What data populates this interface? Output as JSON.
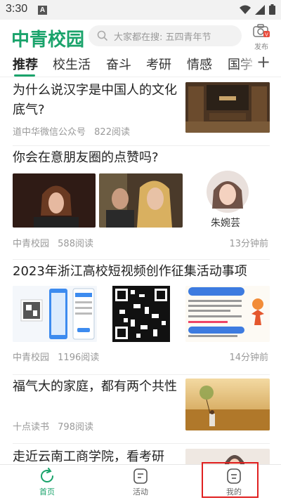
{
  "status_bar": {
    "time": "3:30",
    "notification": "A"
  },
  "header": {
    "logo": "中青校园",
    "search_placeholder": "大家都在搜: 五四青年节",
    "publish_label": "发布",
    "publish_badge": "V"
  },
  "tabs": [
    "推荐",
    "校生活",
    "奋斗",
    "考研",
    "情感",
    "国学"
  ],
  "tab_plus": "+",
  "articles": [
    {
      "title": "为什么说汉字是中国人的文化底气?",
      "source": "道中华微信公众号",
      "reads": "822阅读",
      "time": ""
    },
    {
      "title": "你会在意朋友圈的点赞吗?",
      "source": "中青校园",
      "reads": "588阅读",
      "time": "13分钟前",
      "signature": "朱婉芸"
    },
    {
      "title": "2023年浙江高校短视频创作征集活动事项",
      "source": "中青校园",
      "reads": "1196阅读",
      "time": "14分钟前"
    },
    {
      "title": "福气大的家庭，都有两个共性",
      "source": "十点读书",
      "reads": "798阅读",
      "time": ""
    },
    {
      "title": "走近云南工商学院，看考研",
      "source": "",
      "reads": "",
      "time": ""
    }
  ],
  "bottom_nav": [
    {
      "label": "首页",
      "icon": "refresh-icon",
      "active": true
    },
    {
      "label": "活动",
      "icon": "note-icon",
      "active": false
    },
    {
      "label": "我的",
      "icon": "profile-icon",
      "active": false
    }
  ],
  "colors": {
    "brand": "#1aa36b",
    "highlight": "#e02020"
  }
}
